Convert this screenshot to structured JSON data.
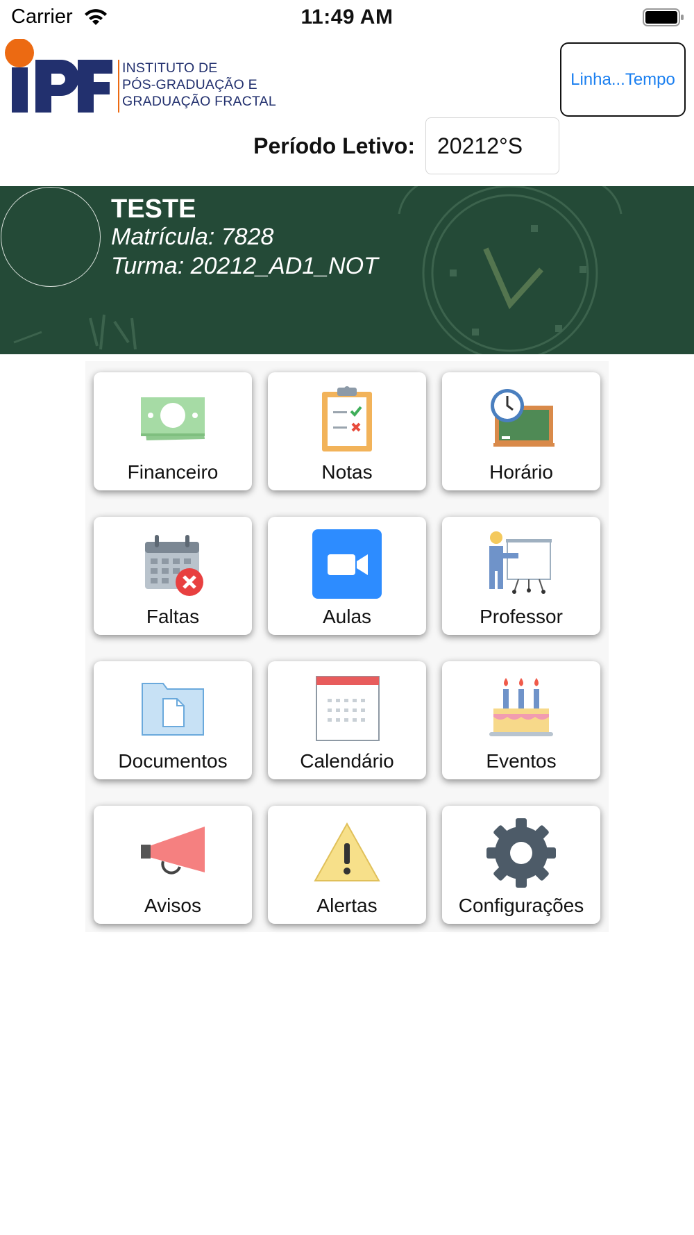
{
  "status_bar": {
    "carrier": "Carrier",
    "time": "11:49 AM",
    "wifi_icon": "wifi-icon",
    "battery_icon": "battery-icon"
  },
  "header": {
    "logo_letters": "IPF",
    "logo_lines": [
      "INSTITUTO DE",
      "PÓS-GRADUAÇÃO E",
      "GRADUAÇÃO FRACTAL"
    ],
    "timeline_button": "Linha...Tempo",
    "period_label": "Período Letivo:",
    "period_value": "20212°S"
  },
  "student": {
    "name": "TESTE",
    "registration": "Matrícula: 7828",
    "class": "Turma: 20212_AD1_NOT"
  },
  "menu": [
    {
      "label": "Financeiro",
      "icon": "money-icon"
    },
    {
      "label": "Notas",
      "icon": "clipboard-icon"
    },
    {
      "label": "Horário",
      "icon": "clock-board-icon"
    },
    {
      "label": "Faltas",
      "icon": "calendar-cancel-icon"
    },
    {
      "label": "Aulas",
      "icon": "video-camera-icon"
    },
    {
      "label": "Professor",
      "icon": "teacher-icon"
    },
    {
      "label": "Documentos",
      "icon": "folder-document-icon"
    },
    {
      "label": "Calendário",
      "icon": "calendar-icon"
    },
    {
      "label": "Eventos",
      "icon": "birthday-cake-icon"
    },
    {
      "label": "Avisos",
      "icon": "megaphone-icon"
    },
    {
      "label": "Alertas",
      "icon": "warning-icon"
    },
    {
      "label": "Configurações",
      "icon": "gear-icon"
    }
  ],
  "colors": {
    "brand_navy": "#22306e",
    "brand_orange": "#ec6a12",
    "banner_green": "#244a37",
    "link_blue": "#1a7ff0"
  }
}
